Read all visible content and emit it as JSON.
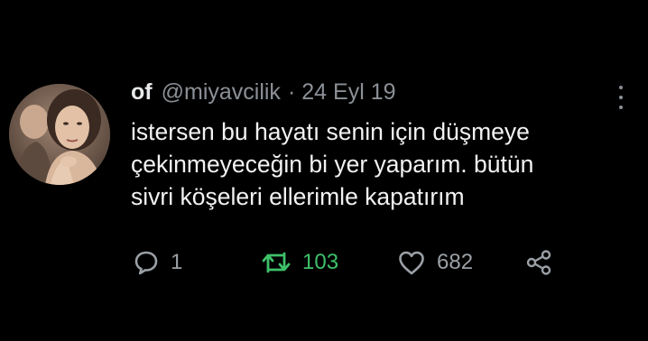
{
  "tweet": {
    "display_name": "of",
    "handle": "@miyavcilik",
    "separator": "·",
    "date": "24 Eyl 19",
    "text_lines": [
      "istersen bu hayatı senin için düşmeye",
      "çekinmeyeceğin bi yer yaparım. bütün",
      "sivri köşeleri ellerimle kapatırım"
    ],
    "more_icon": "more-vertical-icon",
    "avatar": "avatar"
  },
  "actions": {
    "reply": {
      "icon": "reply-icon",
      "count": "1"
    },
    "retweet": {
      "icon": "retweet-icon",
      "count": "103",
      "color": "#3ec06a"
    },
    "like": {
      "icon": "heart-icon",
      "count": "682"
    },
    "share": {
      "icon": "share-icon"
    }
  },
  "colors": {
    "background": "#000000",
    "text": "#f2f2f2",
    "muted": "#8b9096",
    "retweet_active": "#3ec06a"
  }
}
